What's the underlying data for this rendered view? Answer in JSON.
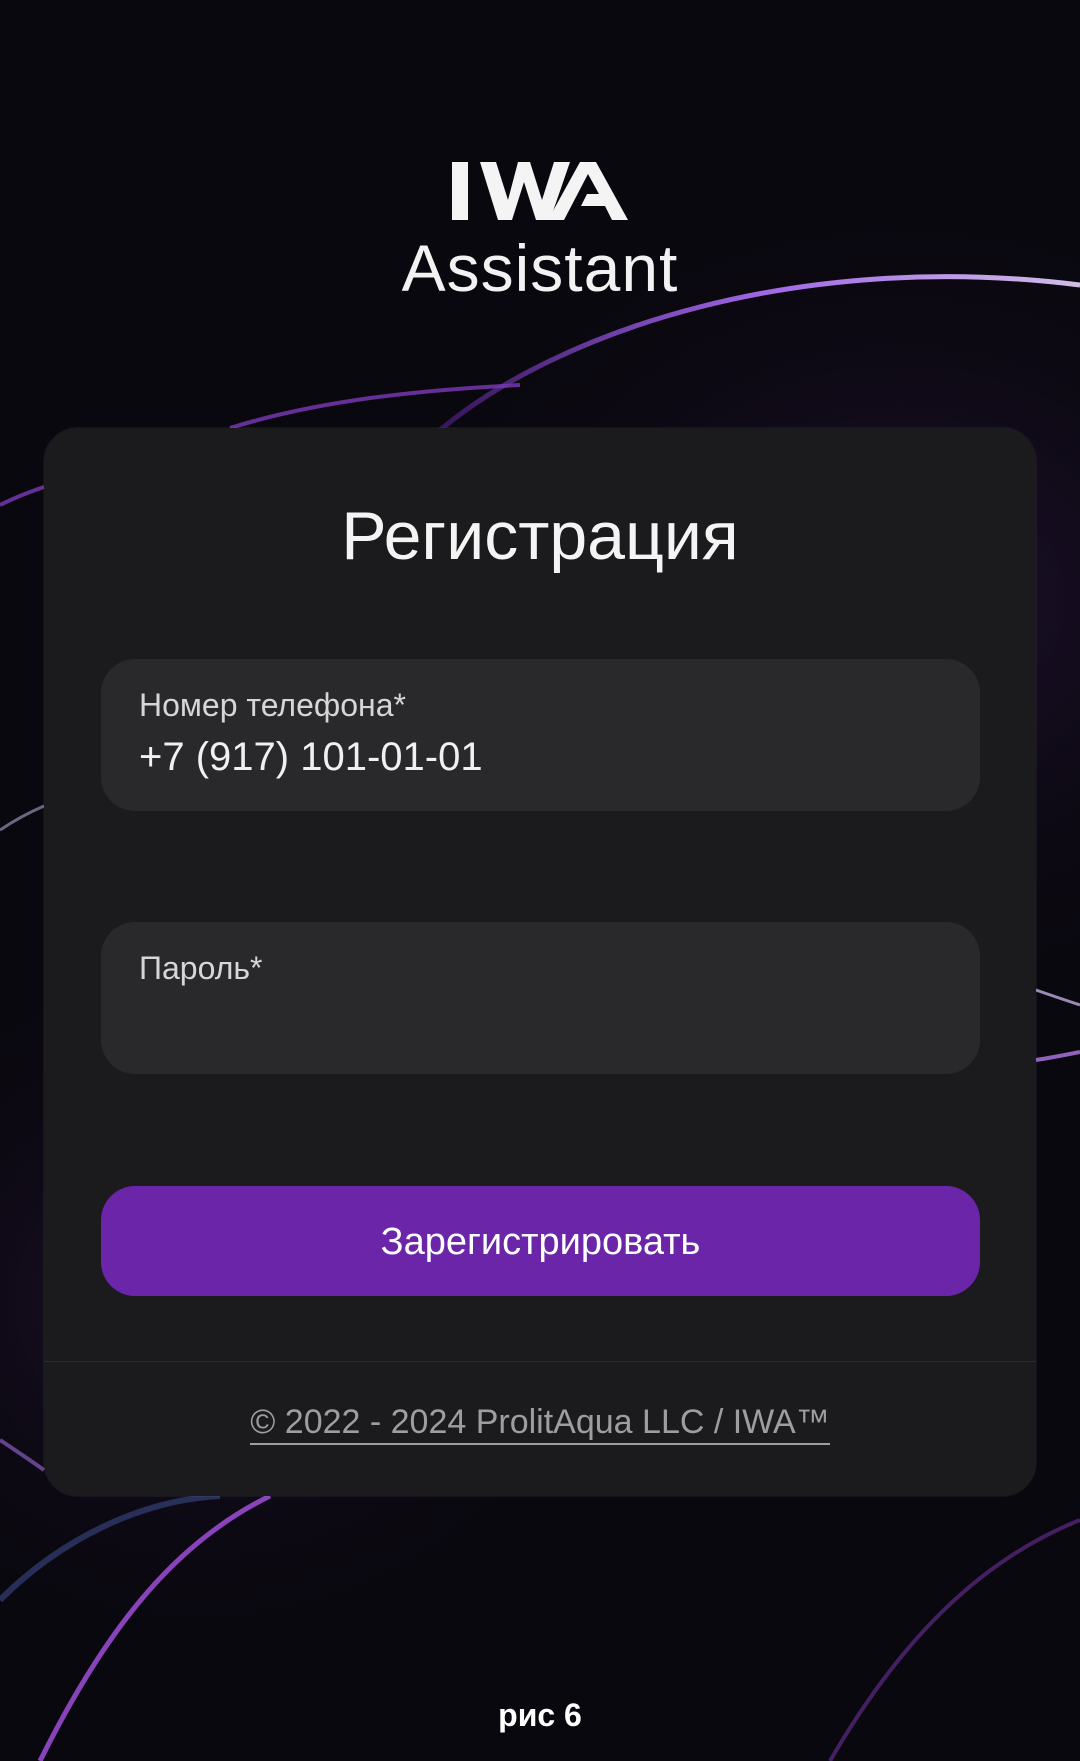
{
  "brand": {
    "logo_text": "IWA",
    "subtitle": "Assistant"
  },
  "form": {
    "title": "Регистрация",
    "phone_label": "Номер телефона*",
    "phone_value": "+7 (917) 101-01-01",
    "password_label": "Пароль*",
    "password_value": "",
    "submit_label": "Зарегистрировать"
  },
  "footer": {
    "copyright": "© 2022 - 2024 ProlitAqua LLC / IWA™"
  },
  "caption": "рис 6",
  "colors": {
    "background": "#09070d",
    "card": "#1b1b1d",
    "field": "#29292c",
    "accent": "#6b25a9",
    "glow": "#8a3fd1"
  }
}
